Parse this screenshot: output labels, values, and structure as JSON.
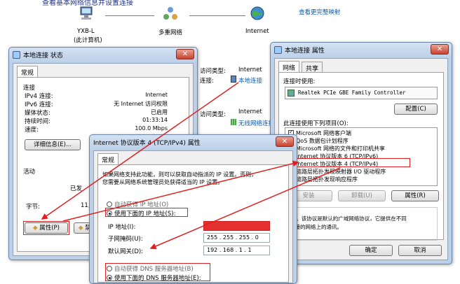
{
  "network_map": {
    "top_text": "查看基本网络信息并设置连接",
    "change_settings_link": "查看更完整映射",
    "computer_name": "YXB-L",
    "computer_sub": "(此计算机)",
    "network_label": "多重网络",
    "internet_label": "Internet"
  },
  "status_window": {
    "title": "本地连接 状态",
    "tab": "常规",
    "section_conn": "连接",
    "rows": [
      {
        "k": "IPv4 连接:",
        "v": "Internet"
      },
      {
        "k": "IPv6 连接:",
        "v": "无 Internet 访问权限"
      },
      {
        "k": "媒体状态:",
        "v": "已启用"
      },
      {
        "k": "持续时间:",
        "v": "01:33:14"
      },
      {
        "k": "速度:",
        "v": "100.0 Mbps"
      }
    ],
    "details_button": "详细信息(E)...",
    "section_activity": "活动",
    "sent_label": "已发",
    "bytes_label": "字节:",
    "bytes_value": "11,28",
    "properties_button": "属性(P)",
    "disable_button": "禁用"
  },
  "middle_panel": {
    "access_type_label": "访问类型:",
    "access_type_value": "Internet",
    "connection_label": "连接:",
    "connection_value": "本地连接",
    "access_type_label_2": "访问类型:",
    "access_type_value_2": "Internet",
    "wireless_value": "无线网络连接"
  },
  "properties_window": {
    "title": "本地连接 属性",
    "tabs": [
      "网络",
      "共享"
    ],
    "connect_using_label": "连接时使用:",
    "adapter": "Realtek PCIe GBE Family Controller",
    "configure_button": "配置(C)",
    "items_label": "此连接使用下列项目(O):",
    "items": [
      "Microsoft 网络客户端",
      "QoS 数据包计划程序",
      "Microsoft 网络的文件和打印机共享",
      "Internet 协议版本 6 (TCP/IPv6)",
      "Internet 协议版本 4 (TCP/IPv4)",
      "链路层拓扑发现映射器 I/O 驱动程序",
      "链路层拓扑发现响应程序"
    ],
    "install_button": "安装",
    "uninstall_button": "卸载(U)",
    "properties_button": "属性(R)",
    "description_text_1": "/IP。该协议是默认的广域网络协议，它提供在不同",
    "description_text_2": "连接的网络上的通讯。",
    "ok_button": "确定",
    "cancel_button": "取消"
  },
  "ipv4_window": {
    "title": "Internet 协议版本 4 (TCP/IPv4) 属性",
    "tab": "常规",
    "intro_1": "如果网络支持此功能，则可以获取自动指派的 IP 设置。否则，",
    "intro_2": "您需要从网络系统管理员处获得适当的 IP 设置。",
    "auto_ip": "自动获得 IP 地址(O)",
    "manual_ip": "使用下面的 IP 地址(S):",
    "ip_label": "IP 地址(I):",
    "ip_value": "",
    "mask_label": "子网掩码(U):",
    "mask_value": "255 . 255 . 255 . 0",
    "gateway_label": "默认网关(D):",
    "gateway_value": "192 . 168 . 1 . 1",
    "auto_dns": "自动获得 DNS 服务器地址(B)",
    "manual_dns": "使用下面的 DNS 服务器地址(E):"
  },
  "colors": {
    "annotation": "#e02020",
    "link": "#0b5aa8"
  }
}
